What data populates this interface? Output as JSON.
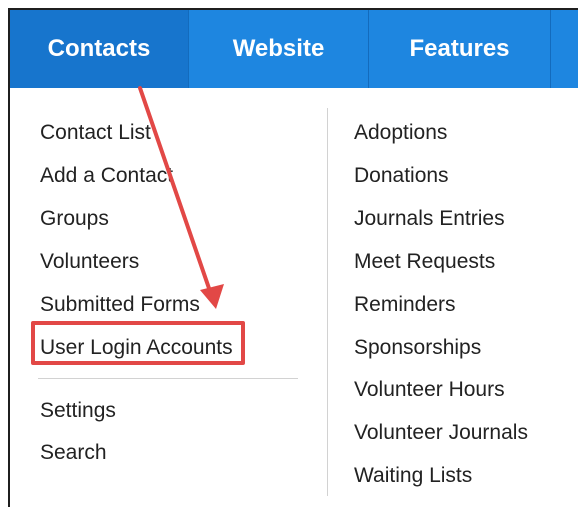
{
  "nav": {
    "tabs": [
      {
        "label": "Contacts",
        "active": true
      },
      {
        "label": "Website"
      },
      {
        "label": "Features"
      }
    ]
  },
  "contacts_menu": {
    "left_primary": [
      "Contact List",
      "Add a Contact",
      "Groups",
      "Volunteers",
      "Submitted Forms",
      "User Login Accounts"
    ],
    "left_secondary": [
      "Settings",
      "Search"
    ],
    "right": [
      "Adoptions",
      "Donations",
      "Journals Entries",
      "Meet Requests",
      "Reminders",
      "Sponsorships",
      "Volunteer Hours",
      "Volunteer Journals",
      "Waiting Lists"
    ]
  },
  "annotation": {
    "highlighted_item": "User Login Accounts",
    "color": "#e24846"
  },
  "colors": {
    "nav_bg": "#1e86e0",
    "nav_active": "#1775cd",
    "nav_text": "#ffffff",
    "menu_text": "#222222"
  }
}
